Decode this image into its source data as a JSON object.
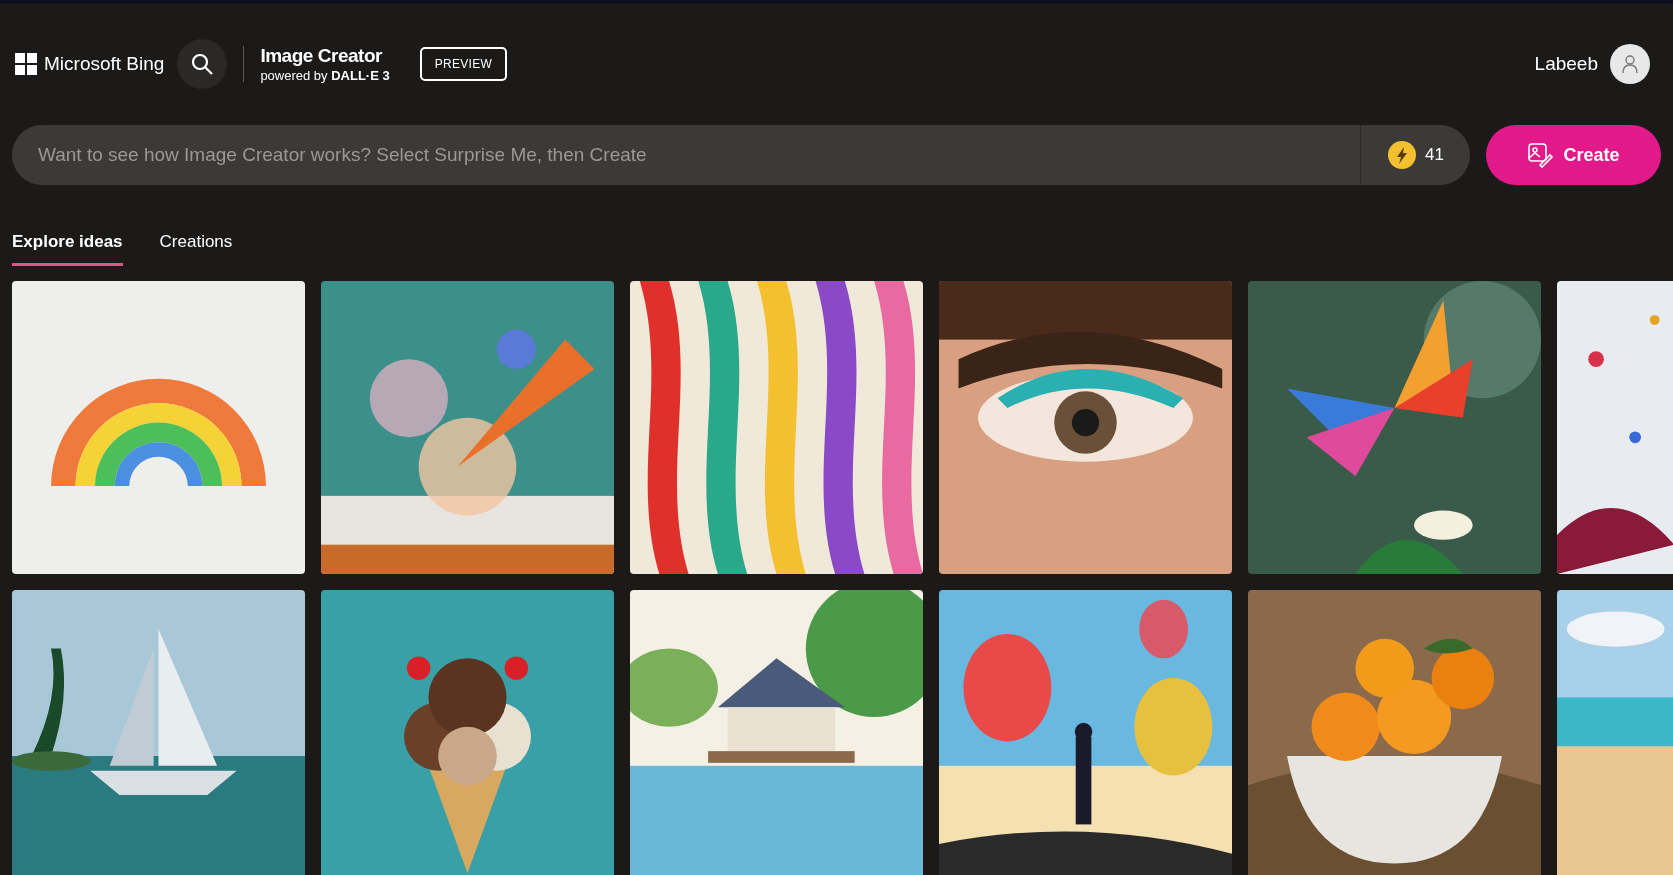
{
  "header": {
    "brand": "Microsoft Bing",
    "product": "Image Creator",
    "powered_by": "powered by **DALL·E 3**",
    "badge": "PREVIEW",
    "user": "Labeeb"
  },
  "prompt": {
    "placeholder": "Want to see how Image Creator works? Select Surprise Me, then Create",
    "boosts": "41",
    "button": "Create"
  },
  "tabs": [
    {
      "label": "Explore ideas",
      "selected": true
    },
    {
      "label": "Creations",
      "selected": false
    }
  ]
}
